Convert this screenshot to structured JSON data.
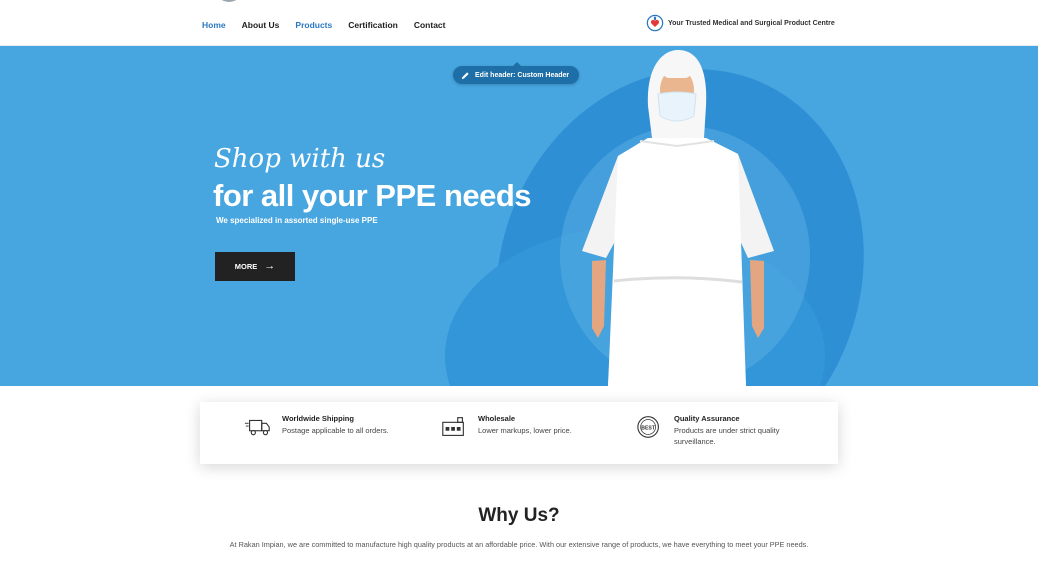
{
  "header": {
    "nav": [
      {
        "label": "Home",
        "active": true
      },
      {
        "label": "About Us",
        "active": false
      },
      {
        "label": "Products",
        "active": false
      },
      {
        "label": "Certification",
        "active": false
      },
      {
        "label": "Contact",
        "active": false
      }
    ],
    "tagline": "Your Trusted Medical and Surgical Product Centre"
  },
  "hero": {
    "edit_pill": "Edit header: Custom Header",
    "script_text": "Shop with us",
    "headline": "for all your PPE needs",
    "subline": "We specialized in assorted single-use PPE",
    "button_label": "MORE"
  },
  "features": [
    {
      "icon": "truck-icon",
      "title": "Worldwide Shipping",
      "desc": "Postage applicable to all orders."
    },
    {
      "icon": "warehouse-icon",
      "title": "Wholesale",
      "desc": "Lower markups, lower price."
    },
    {
      "icon": "best-badge-icon",
      "badge_text": "BEST",
      "title": "Quality Assurance",
      "desc": "Products are under strict quality surveillance."
    }
  ],
  "why": {
    "title": "Why Us?",
    "text": "At Rakan Impian, we are committed to manufacture high quality products at an affordable price. With our extensive range of products, we have everything to meet your PPE needs."
  },
  "colors": {
    "hero_bg": "#47a6e0",
    "accent": "#2b78c2",
    "button_bg": "#222222"
  }
}
